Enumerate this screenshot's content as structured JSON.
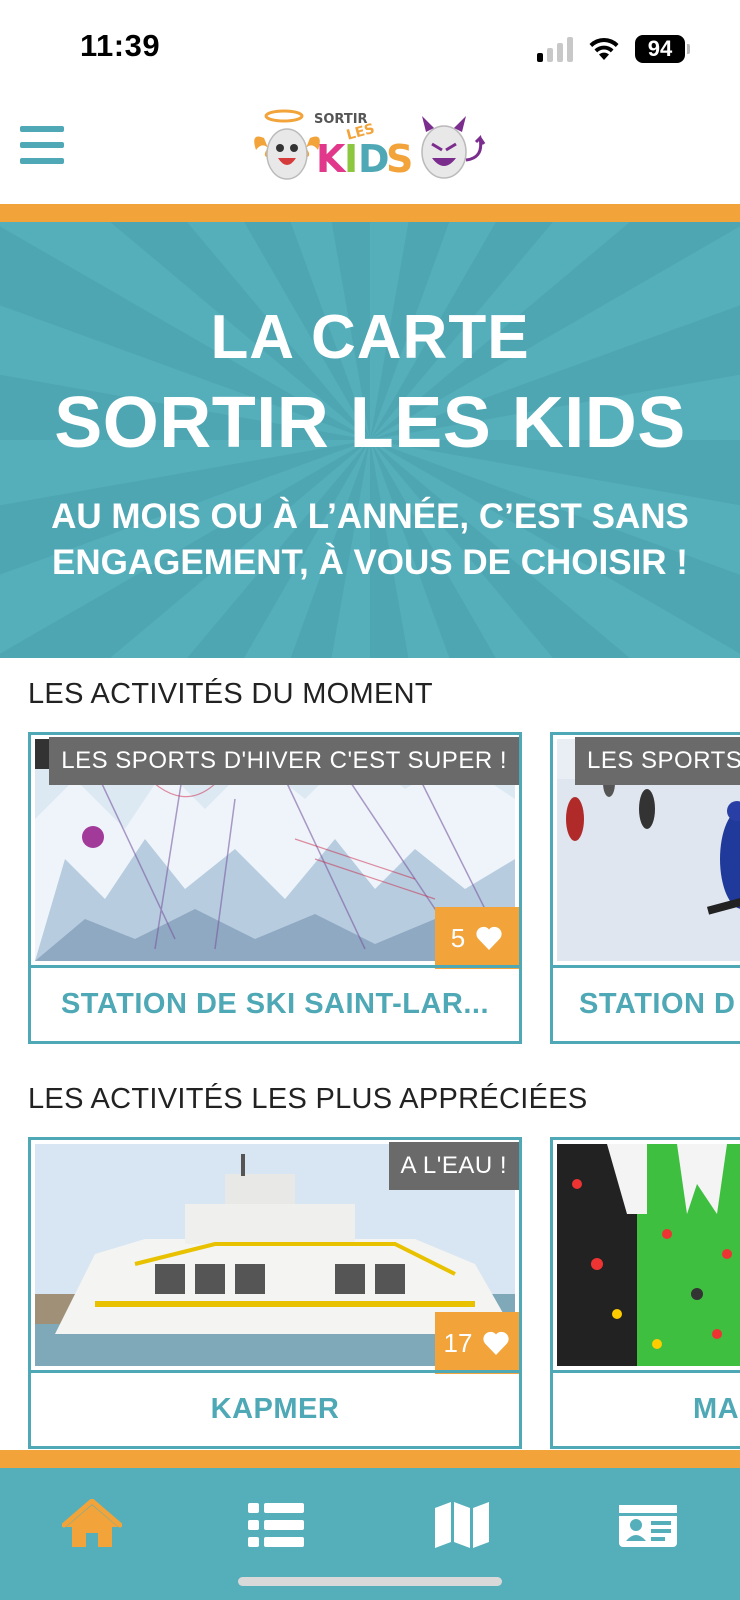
{
  "status_bar": {
    "time": "11:39",
    "battery": "94"
  },
  "header": {
    "logo_text": {
      "top": "SORTIR",
      "mid": "LES",
      "main": "KIDS"
    }
  },
  "hero": {
    "line1": "LA CARTE",
    "line2": "SORTIR LES KIDS",
    "subtitle": "AU MOIS OU À L’ANNÉE, C’EST SANS ENGAGEMENT, À VOUS DE CHOISIR !"
  },
  "sections": {
    "moment": {
      "title": "LES ACTIVITÉS DU MOMENT",
      "cards": [
        {
          "tag": "LES SPORTS D'HIVER C'EST SUPER !",
          "likes": "5",
          "title": "STATION DE SKI SAINT-LAR..."
        },
        {
          "tag": "LES SPORTS",
          "title": "STATION D"
        }
      ]
    },
    "popular": {
      "title": "LES ACTIVITÉS LES PLUS APPRÉCIÉES",
      "cards": [
        {
          "tag": "A L'EAU !",
          "likes": "17",
          "title": "KAPMER"
        },
        {
          "title": "MA"
        }
      ]
    }
  },
  "nav": {
    "items": [
      "home-icon",
      "list-icon",
      "map-icon",
      "id-card-icon"
    ],
    "active_color": "#f2a33a"
  },
  "colors": {
    "teal": "#55afbb",
    "orange": "#f2a33a",
    "card_border": "#4ea8b5"
  }
}
